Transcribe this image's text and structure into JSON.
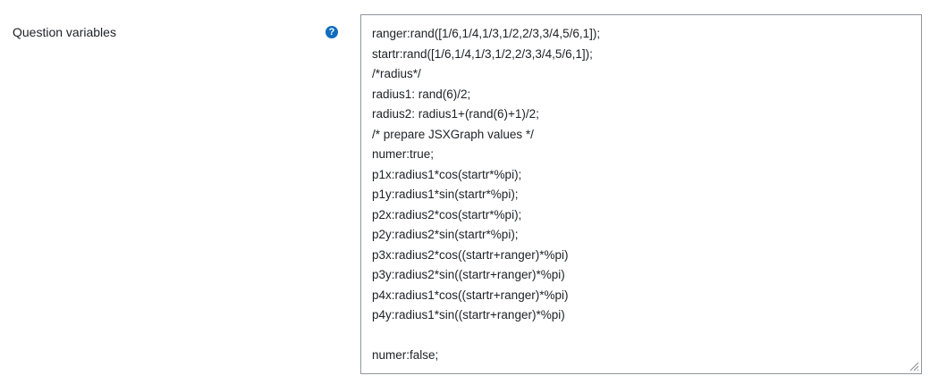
{
  "field": {
    "label": "Question variables",
    "help_icon": "question-circle-icon",
    "help_symbol": "?",
    "accent_color": "#0f6cbf"
  },
  "code_lines": [
    "ranger:rand([1/6,1/4,1/3,1/2,2/3,3/4,5/6,1]);",
    "startr:rand([1/6,1/4,1/3,1/2,2/3,3/4,5/6,1]);",
    "/*radius*/",
    "radius1: rand(6)/2;",
    "radius2: radius1+(rand(6)+1)/2;",
    "/* prepare JSXGraph values */",
    "numer:true;",
    "p1x:radius1*cos(startr*%pi);",
    "p1y:radius1*sin(startr*%pi);",
    "p2x:radius2*cos(startr*%pi);",
    "p2y:radius2*sin(startr*%pi);",
    "p3x:radius2*cos((startr+ranger)*%pi)",
    "p3y:radius2*sin((startr+ranger)*%pi)",
    "p4x:radius1*cos((startr+ranger)*%pi)",
    "p4y:radius1*sin((startr+ranger)*%pi)",
    "",
    "numer:false;"
  ]
}
